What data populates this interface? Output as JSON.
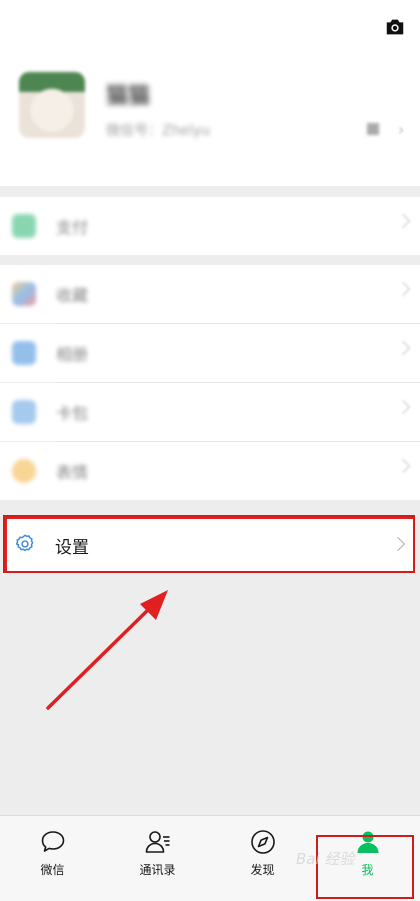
{
  "profile": {
    "nickname": "猫猫",
    "wechat_id": "微信号：Zhelyu",
    "camera_icon": "camera-icon",
    "qr_icon": "qr-code-icon"
  },
  "menu": {
    "pay": {
      "label": "支付",
      "icon": "pay-icon",
      "icon_color": "#2bb673"
    },
    "favorites": {
      "label": "收藏",
      "icon": "favorites-icon",
      "icon_color": "#e8a23b"
    },
    "album": {
      "label": "相册",
      "icon": "album-icon",
      "icon_color": "#3d8bdb"
    },
    "cards": {
      "label": "卡包",
      "icon": "cards-icon",
      "icon_color": "#3d8bdb"
    },
    "stickers": {
      "label": "表情",
      "icon": "sticker-icon",
      "icon_color": "#f2b33d"
    },
    "settings": {
      "label": "设置",
      "icon": "gear-icon",
      "icon_color": "#3d8bdb"
    }
  },
  "tabbar": {
    "chats": {
      "label": "微信",
      "icon": "chat-bubble-icon"
    },
    "contacts": {
      "label": "通讯录",
      "icon": "contacts-icon"
    },
    "discover": {
      "label": "发现",
      "icon": "compass-icon"
    },
    "me": {
      "label": "我",
      "icon": "me-icon",
      "active_color": "#07c160"
    }
  },
  "annotation": {
    "color": "#e02020"
  },
  "watermark": {
    "text": "Bai 经验"
  }
}
